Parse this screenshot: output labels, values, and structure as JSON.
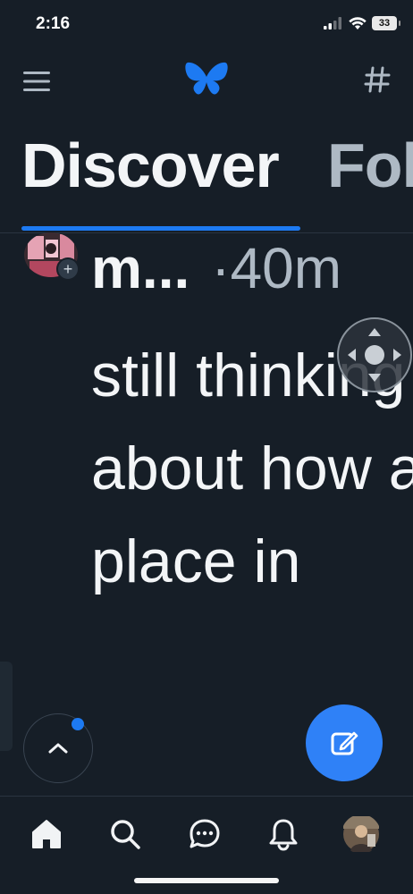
{
  "status_bar": {
    "time": "2:16",
    "battery": "33"
  },
  "header": {
    "logo_icon": "butterfly-icon",
    "menu_icon": "hamburger-icon",
    "feeds_icon": "hash-icon"
  },
  "tabs": [
    {
      "label": "Discover",
      "active": true
    },
    {
      "label": "Following",
      "active": false
    }
  ],
  "post": {
    "author": "m...",
    "time": "·40m",
    "text": "still thinking about how a place in"
  },
  "bottom_nav": [
    {
      "name": "home",
      "icon": "home-icon"
    },
    {
      "name": "search",
      "icon": "search-icon"
    },
    {
      "name": "chat",
      "icon": "chat-icon"
    },
    {
      "name": "notifications",
      "icon": "bell-icon"
    },
    {
      "name": "profile",
      "icon": "avatar"
    }
  ],
  "colors": {
    "background": "#161e27",
    "accent": "#1d7af2",
    "compose": "#2f81f7",
    "muted": "#aeb9c4"
  }
}
